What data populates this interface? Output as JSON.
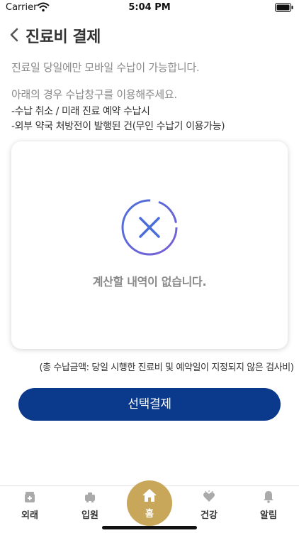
{
  "status_bar": {
    "carrier": "Carrier",
    "time": "5:04 PM"
  },
  "header": {
    "title": "진료비 결제"
  },
  "notice": {
    "line1": "진료일 당일에만 모바일 수납이 가능합니다.",
    "line2": "아래의 경우 수납창구를 이용해주세요.",
    "bullets": [
      "-수납 취소 / 미래 진료 예약 수납시",
      "-외부 약국 처방전이 발행된 건(무인 수납기 이용가능)"
    ]
  },
  "empty_state": {
    "message": "계산할 내역이 없습니다.",
    "icon": "x-circle-icon"
  },
  "amount_note": "(총 수납금액: 당일 시행한 진료비 및 예약일이 지정되지 않은 검사비)",
  "pay_button": {
    "label": "선택결제"
  },
  "tabs": [
    {
      "label": "외래",
      "icon": "outpatient-icon"
    },
    {
      "label": "입원",
      "icon": "inpatient-icon"
    },
    {
      "label": "홈",
      "icon": "home-icon"
    },
    {
      "label": "건강",
      "icon": "health-icon"
    },
    {
      "label": "알림",
      "icon": "bell-icon"
    }
  ],
  "colors": {
    "primary": "#0b3a8c",
    "accent": "#c9a75a",
    "icon_blue": "#4a6fd8"
  }
}
